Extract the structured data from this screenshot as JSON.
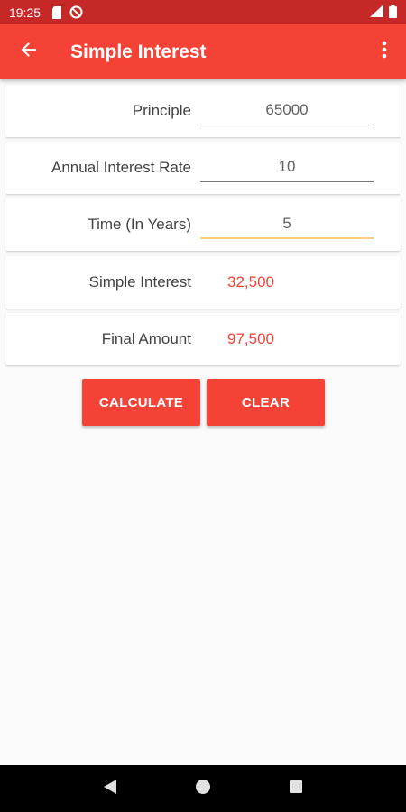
{
  "status_bar": {
    "time": "19:25",
    "icons": [
      "sd-card-icon",
      "do-not-disturb-icon",
      "signal-icon",
      "battery-icon"
    ]
  },
  "app_bar": {
    "title": "Simple Interest",
    "back_icon": "arrow-left-icon",
    "more_icon": "more-vert-icon"
  },
  "form": {
    "principle_label": "Principle",
    "principle_value": "65000",
    "rate_label": "Annual Interest Rate",
    "rate_value": "10",
    "time_label": "Time (In Years)",
    "time_value": "5"
  },
  "results": {
    "interest_label": "Simple Interest",
    "interest_value": "32,500",
    "amount_label": "Final Amount",
    "amount_value": "97,500"
  },
  "buttons": {
    "calculate": "CALCULATE",
    "clear": "CLEAR"
  },
  "nav": {
    "back": "back-triangle-icon",
    "home": "home-circle-icon",
    "recents": "recents-square-icon"
  },
  "colors": {
    "primary": "#f44336",
    "primary_dark": "#c62828",
    "accent_underline": "#ffcc80",
    "result_text": "#f44336"
  }
}
